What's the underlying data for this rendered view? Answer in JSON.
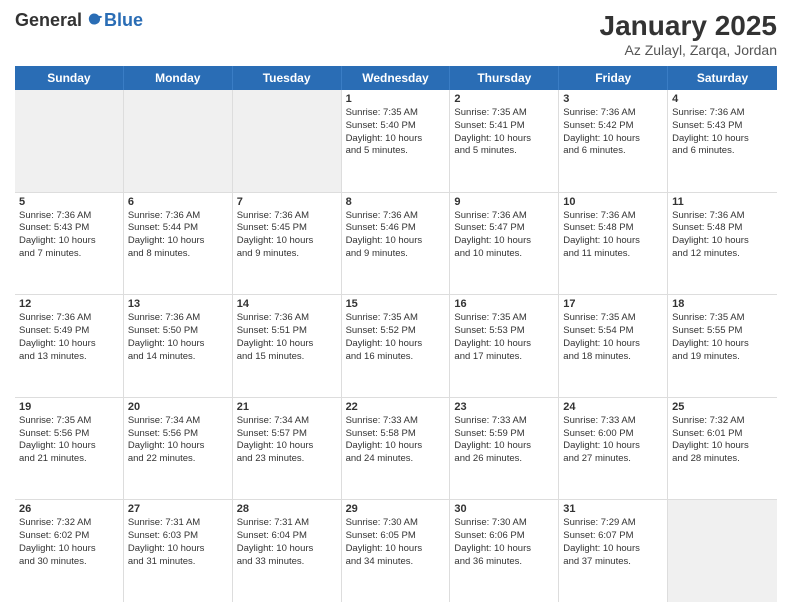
{
  "logo": {
    "general": "General",
    "blue": "Blue"
  },
  "title": "January 2025",
  "location": "Az Zulayl, Zarqa, Jordan",
  "days": [
    "Sunday",
    "Monday",
    "Tuesday",
    "Wednesday",
    "Thursday",
    "Friday",
    "Saturday"
  ],
  "weeks": [
    [
      {
        "day": "",
        "content": []
      },
      {
        "day": "",
        "content": []
      },
      {
        "day": "",
        "content": []
      },
      {
        "day": "1",
        "content": [
          "Sunrise: 7:35 AM",
          "Sunset: 5:40 PM",
          "Daylight: 10 hours",
          "and 5 minutes."
        ]
      },
      {
        "day": "2",
        "content": [
          "Sunrise: 7:35 AM",
          "Sunset: 5:41 PM",
          "Daylight: 10 hours",
          "and 5 minutes."
        ]
      },
      {
        "day": "3",
        "content": [
          "Sunrise: 7:36 AM",
          "Sunset: 5:42 PM",
          "Daylight: 10 hours",
          "and 6 minutes."
        ]
      },
      {
        "day": "4",
        "content": [
          "Sunrise: 7:36 AM",
          "Sunset: 5:43 PM",
          "Daylight: 10 hours",
          "and 6 minutes."
        ]
      }
    ],
    [
      {
        "day": "5",
        "content": [
          "Sunrise: 7:36 AM",
          "Sunset: 5:43 PM",
          "Daylight: 10 hours",
          "and 7 minutes."
        ]
      },
      {
        "day": "6",
        "content": [
          "Sunrise: 7:36 AM",
          "Sunset: 5:44 PM",
          "Daylight: 10 hours",
          "and 8 minutes."
        ]
      },
      {
        "day": "7",
        "content": [
          "Sunrise: 7:36 AM",
          "Sunset: 5:45 PM",
          "Daylight: 10 hours",
          "and 9 minutes."
        ]
      },
      {
        "day": "8",
        "content": [
          "Sunrise: 7:36 AM",
          "Sunset: 5:46 PM",
          "Daylight: 10 hours",
          "and 9 minutes."
        ]
      },
      {
        "day": "9",
        "content": [
          "Sunrise: 7:36 AM",
          "Sunset: 5:47 PM",
          "Daylight: 10 hours",
          "and 10 minutes."
        ]
      },
      {
        "day": "10",
        "content": [
          "Sunrise: 7:36 AM",
          "Sunset: 5:48 PM",
          "Daylight: 10 hours",
          "and 11 minutes."
        ]
      },
      {
        "day": "11",
        "content": [
          "Sunrise: 7:36 AM",
          "Sunset: 5:48 PM",
          "Daylight: 10 hours",
          "and 12 minutes."
        ]
      }
    ],
    [
      {
        "day": "12",
        "content": [
          "Sunrise: 7:36 AM",
          "Sunset: 5:49 PM",
          "Daylight: 10 hours",
          "and 13 minutes."
        ]
      },
      {
        "day": "13",
        "content": [
          "Sunrise: 7:36 AM",
          "Sunset: 5:50 PM",
          "Daylight: 10 hours",
          "and 14 minutes."
        ]
      },
      {
        "day": "14",
        "content": [
          "Sunrise: 7:36 AM",
          "Sunset: 5:51 PM",
          "Daylight: 10 hours",
          "and 15 minutes."
        ]
      },
      {
        "day": "15",
        "content": [
          "Sunrise: 7:35 AM",
          "Sunset: 5:52 PM",
          "Daylight: 10 hours",
          "and 16 minutes."
        ]
      },
      {
        "day": "16",
        "content": [
          "Sunrise: 7:35 AM",
          "Sunset: 5:53 PM",
          "Daylight: 10 hours",
          "and 17 minutes."
        ]
      },
      {
        "day": "17",
        "content": [
          "Sunrise: 7:35 AM",
          "Sunset: 5:54 PM",
          "Daylight: 10 hours",
          "and 18 minutes."
        ]
      },
      {
        "day": "18",
        "content": [
          "Sunrise: 7:35 AM",
          "Sunset: 5:55 PM",
          "Daylight: 10 hours",
          "and 19 minutes."
        ]
      }
    ],
    [
      {
        "day": "19",
        "content": [
          "Sunrise: 7:35 AM",
          "Sunset: 5:56 PM",
          "Daylight: 10 hours",
          "and 21 minutes."
        ]
      },
      {
        "day": "20",
        "content": [
          "Sunrise: 7:34 AM",
          "Sunset: 5:56 PM",
          "Daylight: 10 hours",
          "and 22 minutes."
        ]
      },
      {
        "day": "21",
        "content": [
          "Sunrise: 7:34 AM",
          "Sunset: 5:57 PM",
          "Daylight: 10 hours",
          "and 23 minutes."
        ]
      },
      {
        "day": "22",
        "content": [
          "Sunrise: 7:33 AM",
          "Sunset: 5:58 PM",
          "Daylight: 10 hours",
          "and 24 minutes."
        ]
      },
      {
        "day": "23",
        "content": [
          "Sunrise: 7:33 AM",
          "Sunset: 5:59 PM",
          "Daylight: 10 hours",
          "and 26 minutes."
        ]
      },
      {
        "day": "24",
        "content": [
          "Sunrise: 7:33 AM",
          "Sunset: 6:00 PM",
          "Daylight: 10 hours",
          "and 27 minutes."
        ]
      },
      {
        "day": "25",
        "content": [
          "Sunrise: 7:32 AM",
          "Sunset: 6:01 PM",
          "Daylight: 10 hours",
          "and 28 minutes."
        ]
      }
    ],
    [
      {
        "day": "26",
        "content": [
          "Sunrise: 7:32 AM",
          "Sunset: 6:02 PM",
          "Daylight: 10 hours",
          "and 30 minutes."
        ]
      },
      {
        "day": "27",
        "content": [
          "Sunrise: 7:31 AM",
          "Sunset: 6:03 PM",
          "Daylight: 10 hours",
          "and 31 minutes."
        ]
      },
      {
        "day": "28",
        "content": [
          "Sunrise: 7:31 AM",
          "Sunset: 6:04 PM",
          "Daylight: 10 hours",
          "and 33 minutes."
        ]
      },
      {
        "day": "29",
        "content": [
          "Sunrise: 7:30 AM",
          "Sunset: 6:05 PM",
          "Daylight: 10 hours",
          "and 34 minutes."
        ]
      },
      {
        "day": "30",
        "content": [
          "Sunrise: 7:30 AM",
          "Sunset: 6:06 PM",
          "Daylight: 10 hours",
          "and 36 minutes."
        ]
      },
      {
        "day": "31",
        "content": [
          "Sunrise: 7:29 AM",
          "Sunset: 6:07 PM",
          "Daylight: 10 hours",
          "and 37 minutes."
        ]
      },
      {
        "day": "",
        "content": []
      }
    ]
  ]
}
